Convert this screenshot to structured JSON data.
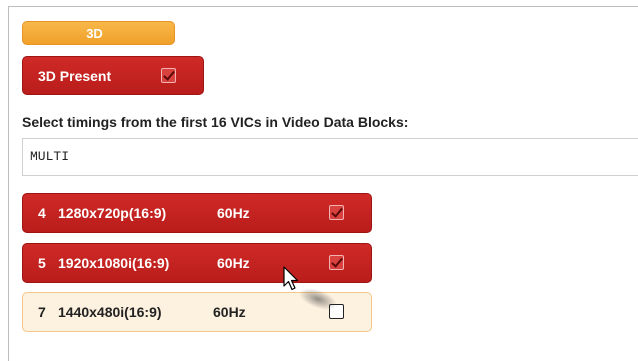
{
  "tab": {
    "label": "3D"
  },
  "present_button": {
    "label": "3D Present",
    "checked": true
  },
  "section": {
    "label": "Select timings from the first 16 VICs in Video Data Blocks:"
  },
  "mode_field": {
    "value": "MULTI"
  },
  "timings": [
    {
      "vic": "4",
      "resolution": "1280x720p(16:9)",
      "rate": "60Hz",
      "checked": true
    },
    {
      "vic": "5",
      "resolution": "1920x1080i(16:9)",
      "rate": "60Hz",
      "checked": true
    },
    {
      "vic": "7",
      "resolution": "1440x480i(16:9)",
      "rate": "60Hz",
      "checked": false
    }
  ],
  "colors": {
    "tab_orange": "#f0a02a",
    "selected_red": "#c1211f",
    "unselected_bg": "#fdf1df",
    "unselected_border": "#f5c788"
  },
  "icons": {
    "checkbox_checked": "check-icon",
    "cursor": "mouse-pointer-icon"
  }
}
